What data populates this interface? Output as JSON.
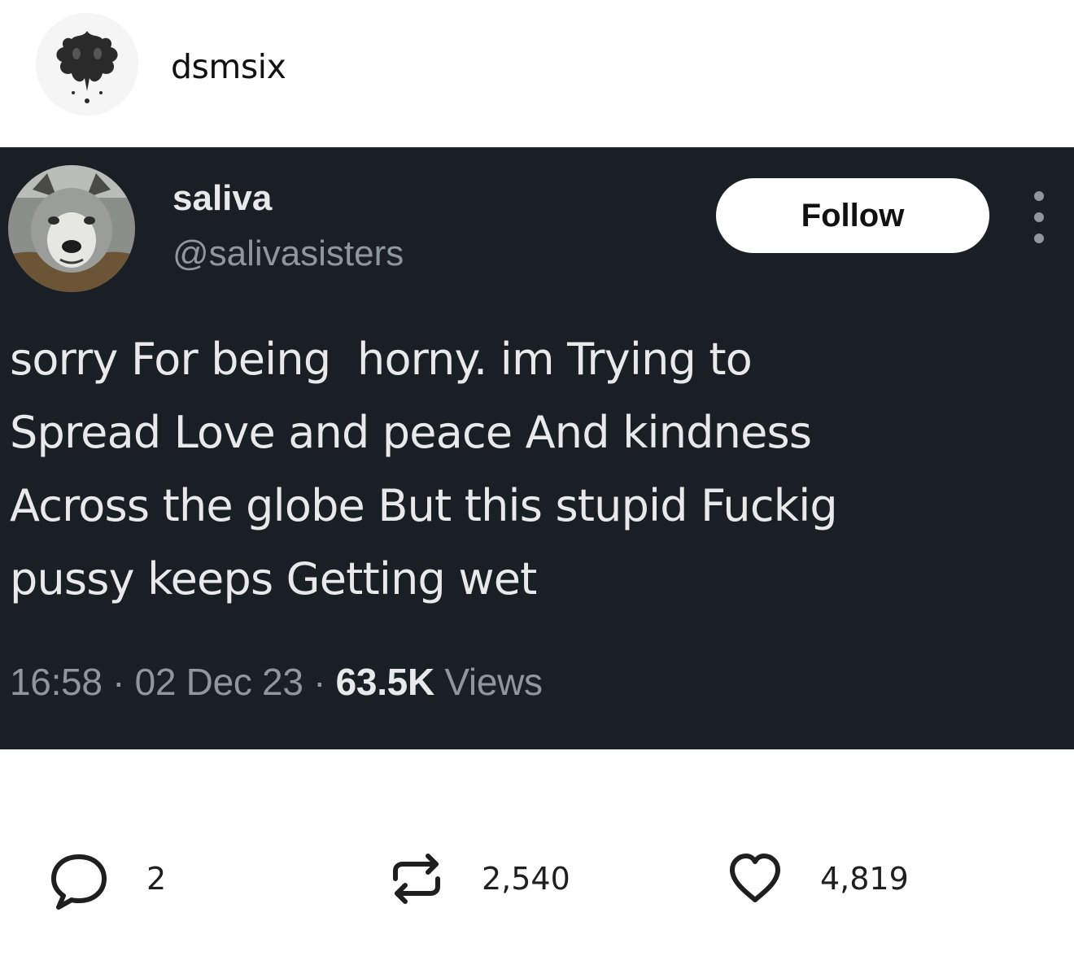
{
  "post": {
    "poster_name": "dsmsix"
  },
  "tweet": {
    "display_name": "saliva",
    "handle": "@salivasisters",
    "follow_label": "Follow",
    "text": "sorry For being  horny. im Trying to\nSpread Love and peace And kindness\nAcross the globe But this stupid Fuckig\npussy keeps Getting wet",
    "time": "16:58",
    "separator": "·",
    "date": "02 Dec 23",
    "views_count": "63.5K",
    "views_label": "Views"
  },
  "actions": {
    "replies": "2",
    "reblogs": "2,540",
    "likes": "4,819"
  },
  "colors": {
    "card_background": "#1a1f26",
    "text_primary": "#e7e9ea",
    "text_secondary": "#8f979e",
    "follow_button": "#ffffff"
  },
  "icons": {
    "poster_avatar": "inkblot-avatar-icon",
    "tweet_avatar": "wolf-avatar-icon",
    "more": "more-vertical-icon",
    "reply": "reply-bubble-icon",
    "reblog": "reblog-icon",
    "like": "heart-icon"
  }
}
